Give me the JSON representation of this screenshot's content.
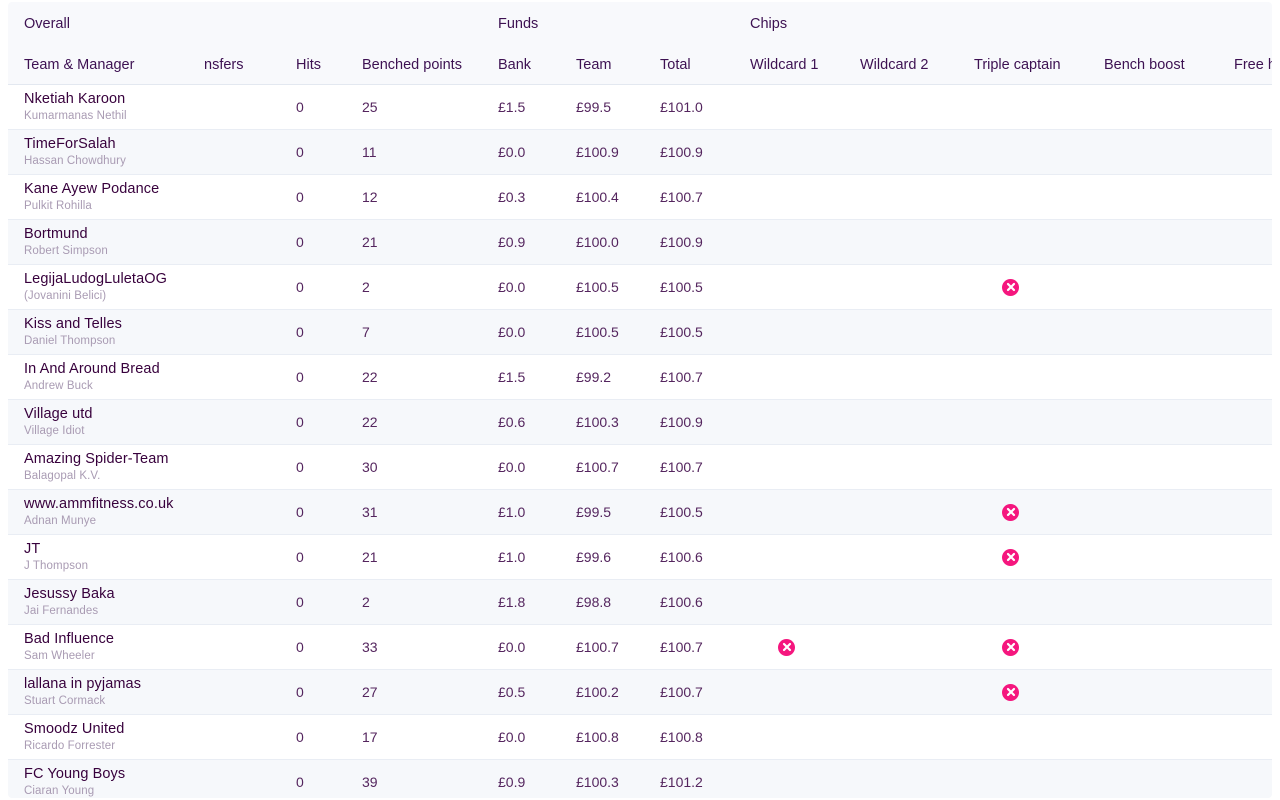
{
  "table": {
    "group_headers": [
      {
        "label": "Overall",
        "span": 4
      },
      {
        "label": "Funds",
        "span": 3
      },
      {
        "label": "Chips",
        "span": 5
      }
    ],
    "columns": [
      "Team & Manager",
      "nsfers",
      "Hits",
      "Benched points",
      "Bank",
      "Team",
      "Total",
      "Wildcard 1",
      "Wildcard 2",
      "Triple captain",
      "Bench boost",
      "Free hit"
    ],
    "chip_icon": "cross-circle-icon",
    "accent_color": "#f5167e",
    "text_color": "#37003c",
    "rows": [
      {
        "team": "Nketiah Karoon",
        "manager": "Kumarmanas Nethil",
        "transfers": "",
        "hits": "0",
        "benched_points": "25",
        "bank": "£1.5",
        "team_value": "£99.5",
        "total": "£101.0",
        "wildcard_1": false,
        "wildcard_2": false,
        "triple_captain": false,
        "bench_boost": false,
        "free_hit": false
      },
      {
        "team": "TimeForSalah",
        "manager": "Hassan Chowdhury",
        "transfers": "",
        "hits": "0",
        "benched_points": "11",
        "bank": "£0.0",
        "team_value": "£100.9",
        "total": "£100.9",
        "wildcard_1": false,
        "wildcard_2": false,
        "triple_captain": false,
        "bench_boost": false,
        "free_hit": false
      },
      {
        "team": "Kane Ayew Podance",
        "manager": "Pulkit Rohilla",
        "transfers": "",
        "hits": "0",
        "benched_points": "12",
        "bank": "£0.3",
        "team_value": "£100.4",
        "total": "£100.7",
        "wildcard_1": false,
        "wildcard_2": false,
        "triple_captain": false,
        "bench_boost": false,
        "free_hit": false
      },
      {
        "team": "Bortmund",
        "manager": "Robert Simpson",
        "transfers": "",
        "hits": "0",
        "benched_points": "21",
        "bank": "£0.9",
        "team_value": "£100.0",
        "total": "£100.9",
        "wildcard_1": false,
        "wildcard_2": false,
        "triple_captain": false,
        "bench_boost": false,
        "free_hit": false
      },
      {
        "team": "LegijaLudogLuletaOG",
        "manager": "(Jovanini Belici)",
        "transfers": "",
        "hits": "0",
        "benched_points": "2",
        "bank": "£0.0",
        "team_value": "£100.5",
        "total": "£100.5",
        "wildcard_1": false,
        "wildcard_2": false,
        "triple_captain": true,
        "bench_boost": false,
        "free_hit": false
      },
      {
        "team": "Kiss and Telles",
        "manager": "Daniel Thompson",
        "transfers": "",
        "hits": "0",
        "benched_points": "7",
        "bank": "£0.0",
        "team_value": "£100.5",
        "total": "£100.5",
        "wildcard_1": false,
        "wildcard_2": false,
        "triple_captain": false,
        "bench_boost": false,
        "free_hit": false
      },
      {
        "team": "In And Around Bread",
        "manager": "Andrew Buck",
        "transfers": "",
        "hits": "0",
        "benched_points": "22",
        "bank": "£1.5",
        "team_value": "£99.2",
        "total": "£100.7",
        "wildcard_1": false,
        "wildcard_2": false,
        "triple_captain": false,
        "bench_boost": false,
        "free_hit": false
      },
      {
        "team": "Village utd",
        "manager": "Village Idiot",
        "transfers": "",
        "hits": "0",
        "benched_points": "22",
        "bank": "£0.6",
        "team_value": "£100.3",
        "total": "£100.9",
        "wildcard_1": false,
        "wildcard_2": false,
        "triple_captain": false,
        "bench_boost": false,
        "free_hit": false
      },
      {
        "team": "Amazing Spider-Team",
        "manager": "Balagopal K.V.",
        "transfers": "",
        "hits": "0",
        "benched_points": "30",
        "bank": "£0.0",
        "team_value": "£100.7",
        "total": "£100.7",
        "wildcard_1": false,
        "wildcard_2": false,
        "triple_captain": false,
        "bench_boost": false,
        "free_hit": false
      },
      {
        "team": "www.ammfitness.co.uk",
        "manager": "Adnan Munye",
        "transfers": "",
        "hits": "0",
        "benched_points": "31",
        "bank": "£1.0",
        "team_value": "£99.5",
        "total": "£100.5",
        "wildcard_1": false,
        "wildcard_2": false,
        "triple_captain": true,
        "bench_boost": false,
        "free_hit": false
      },
      {
        "team": "JT",
        "manager": "J Thompson",
        "transfers": "",
        "hits": "0",
        "benched_points": "21",
        "bank": "£1.0",
        "team_value": "£99.6",
        "total": "£100.6",
        "wildcard_1": false,
        "wildcard_2": false,
        "triple_captain": true,
        "bench_boost": false,
        "free_hit": false
      },
      {
        "team": "Jesussy Baka",
        "manager": "Jai Fernandes",
        "transfers": "",
        "hits": "0",
        "benched_points": "2",
        "bank": "£1.8",
        "team_value": "£98.8",
        "total": "£100.6",
        "wildcard_1": false,
        "wildcard_2": false,
        "triple_captain": false,
        "bench_boost": false,
        "free_hit": false
      },
      {
        "team": "Bad Influence",
        "manager": "Sam Wheeler",
        "transfers": "",
        "hits": "0",
        "benched_points": "33",
        "bank": "£0.0",
        "team_value": "£100.7",
        "total": "£100.7",
        "wildcard_1": true,
        "wildcard_2": false,
        "triple_captain": true,
        "bench_boost": false,
        "free_hit": false
      },
      {
        "team": "lallana in pyjamas",
        "manager": "Stuart Cormack",
        "transfers": "",
        "hits": "0",
        "benched_points": "27",
        "bank": "£0.5",
        "team_value": "£100.2",
        "total": "£100.7",
        "wildcard_1": false,
        "wildcard_2": false,
        "triple_captain": true,
        "bench_boost": false,
        "free_hit": false
      },
      {
        "team": "Smoodz United",
        "manager": "Ricardo Forrester",
        "transfers": "",
        "hits": "0",
        "benched_points": "17",
        "bank": "£0.0",
        "team_value": "£100.8",
        "total": "£100.8",
        "wildcard_1": false,
        "wildcard_2": false,
        "triple_captain": false,
        "bench_boost": false,
        "free_hit": false
      },
      {
        "team": "FC Young Boys",
        "manager": "Ciaran Young",
        "transfers": "",
        "hits": "0",
        "benched_points": "39",
        "bank": "£0.9",
        "team_value": "£100.3",
        "total": "£101.2",
        "wildcard_1": false,
        "wildcard_2": false,
        "triple_captain": false,
        "bench_boost": false,
        "free_hit": false
      }
    ]
  }
}
